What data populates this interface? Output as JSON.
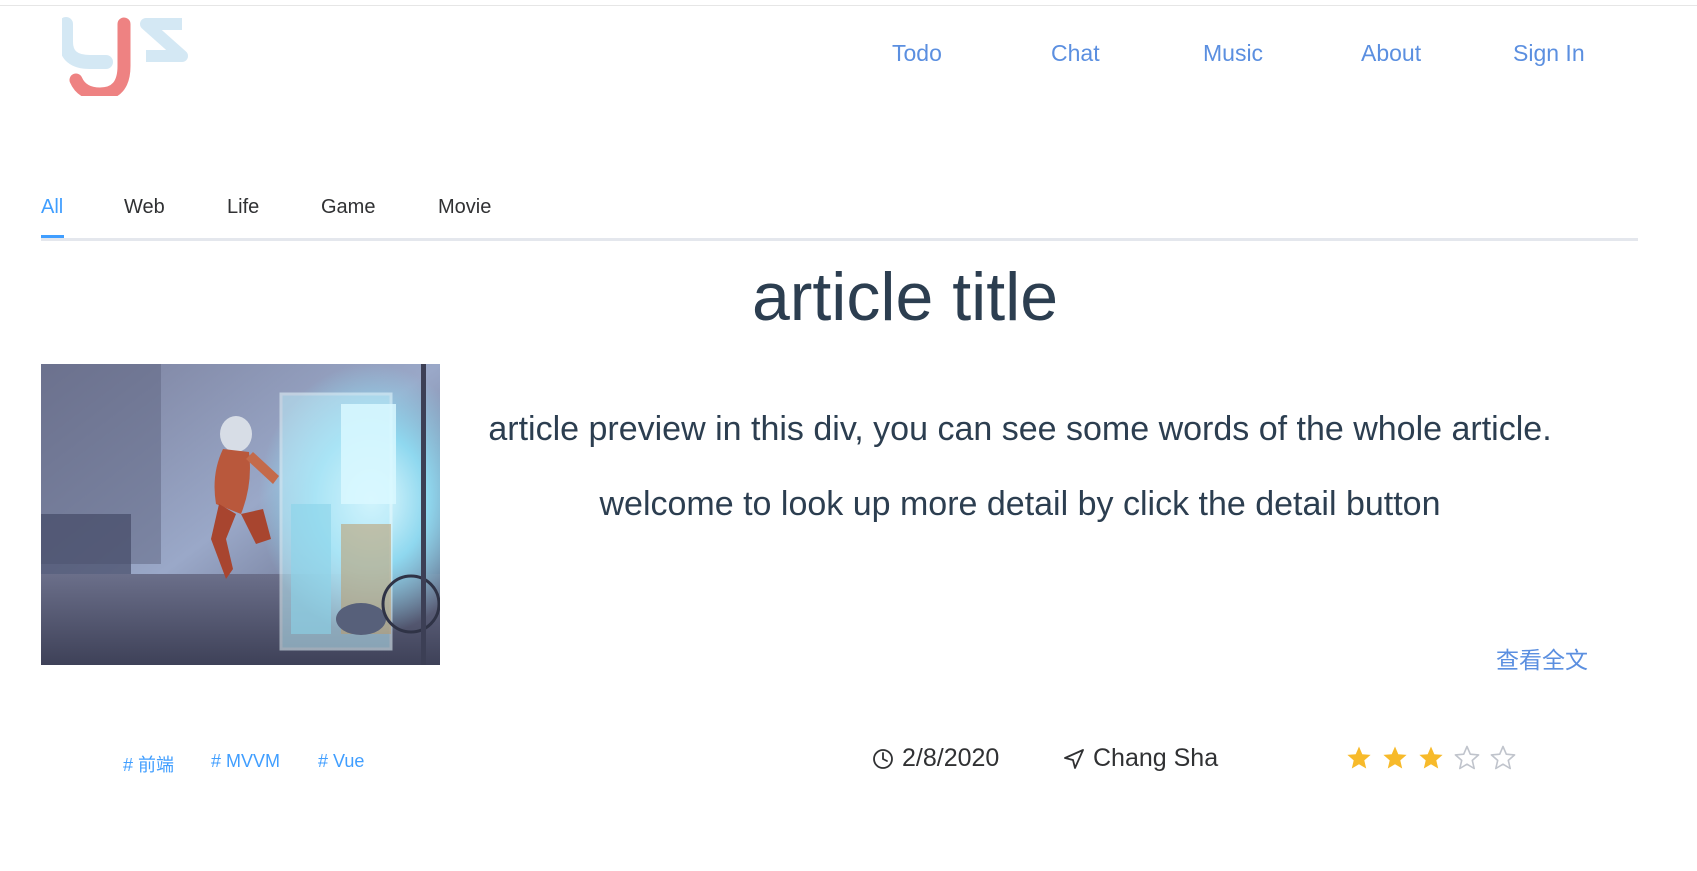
{
  "header": {
    "nav": [
      {
        "label": "Todo"
      },
      {
        "label": "Chat"
      },
      {
        "label": "Music"
      },
      {
        "label": "About"
      },
      {
        "label": "Sign In"
      }
    ]
  },
  "tabs": {
    "items": [
      {
        "label": "All",
        "active": true
      },
      {
        "label": "Web",
        "active": false
      },
      {
        "label": "Life",
        "active": false
      },
      {
        "label": "Game",
        "active": false
      },
      {
        "label": "Movie",
        "active": false
      }
    ]
  },
  "article": {
    "title": "article title",
    "preview_line1": "article preview in this div, you can see some words of the whole article.",
    "preview_line2": "welcome to look up more detail by click the detail button",
    "detail_link": "查看全文",
    "tags": [
      "# 前端",
      "# MVVM",
      "# Vue"
    ],
    "date": "2/8/2020",
    "location": "Chang Sha",
    "rating": 3,
    "rating_max": 5
  },
  "colors": {
    "accent": "#409eff",
    "link": "#5b8fe0",
    "text": "#2c3e50",
    "star_filled": "#f7ba2a",
    "star_empty": "#c0c4cc"
  },
  "icons": {
    "logo": "ysz-logo",
    "date": "clock-icon",
    "location": "navigation-arrow-icon",
    "rating": "star-icon"
  }
}
